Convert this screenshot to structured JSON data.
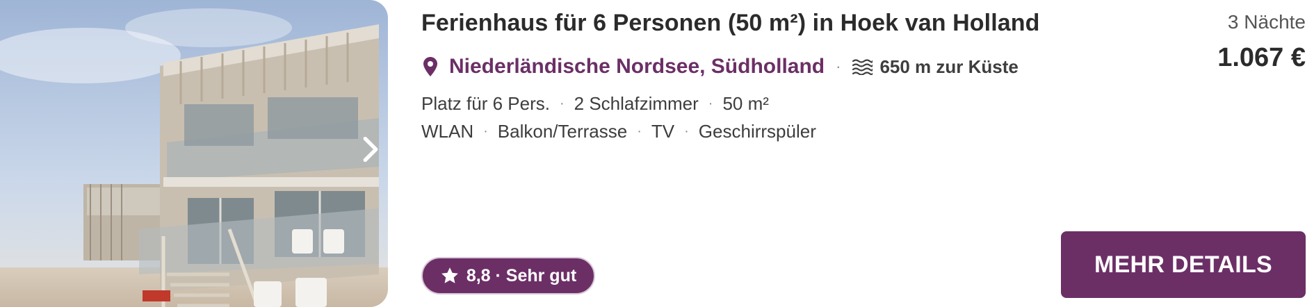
{
  "listing": {
    "title": "Ferienhaus für 6 Personen (50 m²) in Hoek van Holland",
    "region": "Niederländische Nordsee, Südholland",
    "separator": "·",
    "coast_distance": "650 m zur Küste",
    "facts": [
      "Platz für 6 Pers.",
      "2 Schlafzimmer",
      "50 m²"
    ],
    "amenities": [
      "WLAN",
      "Balkon/Terrasse",
      "TV",
      "Geschirrspüler"
    ],
    "rating": "8,8 · Sehr gut"
  },
  "pricing": {
    "nights": "3 Nächte",
    "price": "1.067 €"
  },
  "actions": {
    "details_label": "MEHR DETAILS"
  },
  "icons": {
    "location": "map-pin-icon",
    "coast": "waves-icon",
    "rating": "star-icon",
    "gallery_next": "chevron-right-icon"
  },
  "colors": {
    "brand": "#6b2f66",
    "text": "#2b2b2b",
    "muted": "#8a8a8a"
  }
}
